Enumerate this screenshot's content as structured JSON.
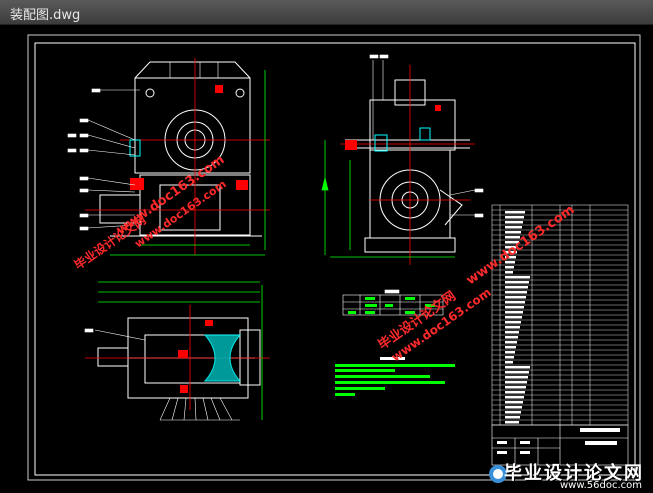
{
  "window": {
    "title": "装配图.dwg"
  },
  "drawing": {
    "colors": {
      "background": "#000000",
      "lines": "#ffffff",
      "dims": "#00ff00",
      "red": "#ff0000",
      "cyan": "#00ffff",
      "magenta": "#ff00ff",
      "watermark": "#ff2a2a"
    },
    "title_block": {
      "school": "辽宁工程技术大学",
      "drawing_name": "蜗杆减速器"
    }
  },
  "watermarks": {
    "site1": "www.doc163.com",
    "site2": "毕业设计论文网",
    "badge_main": "毕业设计论文网",
    "badge_sub": "www.56doc.com"
  }
}
